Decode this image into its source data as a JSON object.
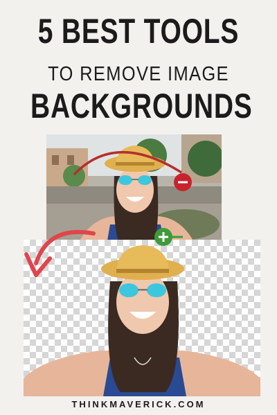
{
  "header": {
    "line1": "5 BEST TOOLS",
    "line2": "TO REMOVE IMAGE",
    "line3": "BACKGROUNDS"
  },
  "footer": {
    "site": "THINKMAVERICK.COM"
  },
  "icons": {
    "minus": "minus-circle-icon",
    "plus": "plus-circle-icon",
    "arrow": "curved-arrow-icon"
  },
  "colors": {
    "background": "#f2f1ee",
    "title": "#1b1b1b",
    "minus": "#c8232d",
    "plus": "#3f9a3a",
    "arrow": "#e0454c",
    "hat": "#e0b04e",
    "lens": "#3cc7df"
  }
}
